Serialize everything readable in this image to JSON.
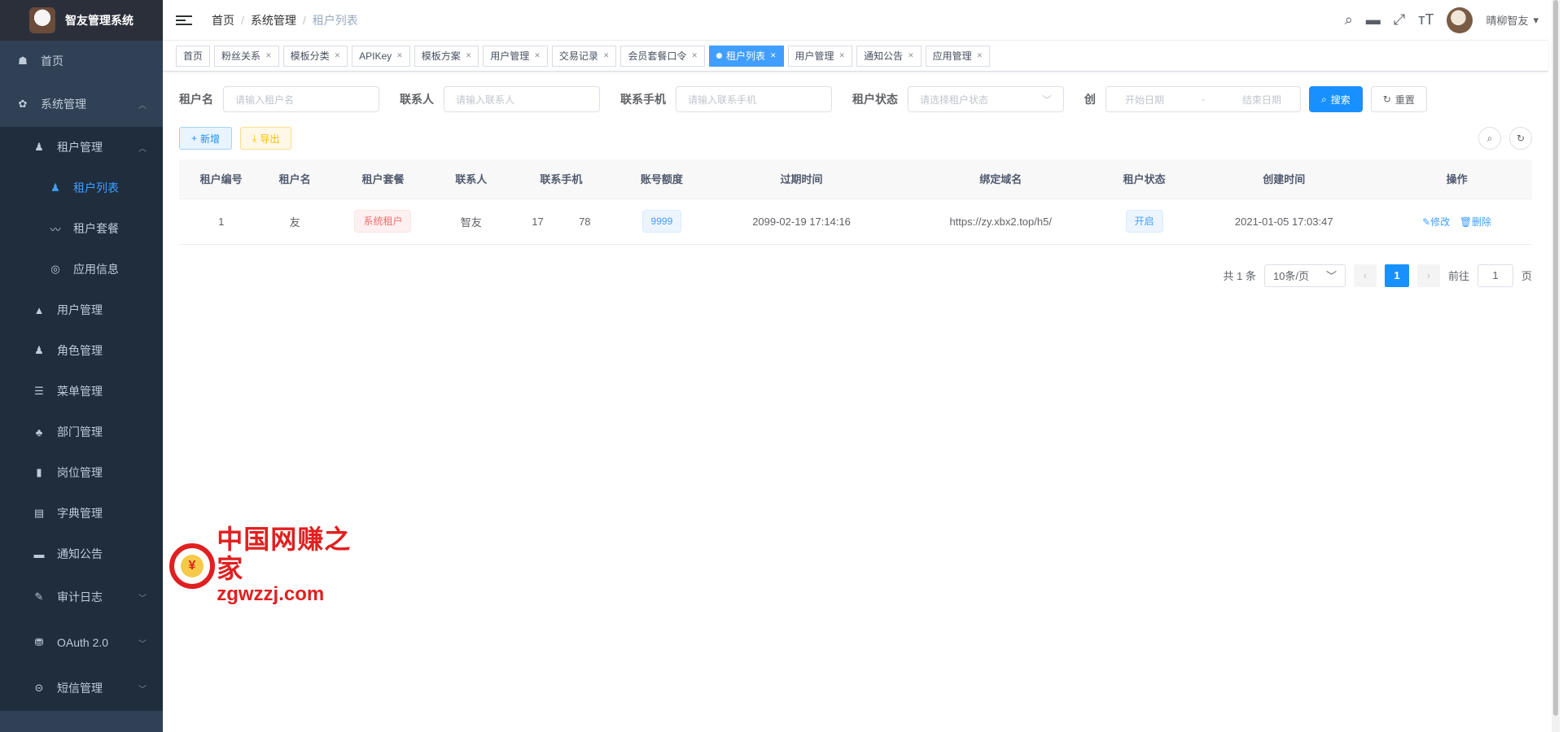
{
  "sidebar": {
    "title": "智友管理系统",
    "home": "首页",
    "system": "系统管理",
    "tenant_mgmt": "租户管理",
    "tenant_list": "租户列表",
    "tenant_package": "租户套餐",
    "app_info": "应用信息",
    "user_mgmt": "用户管理",
    "role_mgmt": "角色管理",
    "menu_mgmt": "菜单管理",
    "dept_mgmt": "部门管理",
    "post_mgmt": "岗位管理",
    "dict_mgmt": "字典管理",
    "notice": "通知公告",
    "audit_log": "审计日志",
    "oauth": "OAuth 2.0",
    "sms": "短信管理"
  },
  "header": {
    "breadcrumb": [
      "首页",
      "系统管理",
      "租户列表"
    ],
    "user_name": "晴柳智友"
  },
  "tags": [
    {
      "label": "首页",
      "closable": false
    },
    {
      "label": "粉丝关系",
      "closable": true
    },
    {
      "label": "模板分类",
      "closable": true
    },
    {
      "label": "APIKey",
      "closable": true
    },
    {
      "label": "模板方案",
      "closable": true
    },
    {
      "label": "用户管理",
      "closable": true
    },
    {
      "label": "交易记录",
      "closable": true
    },
    {
      "label": "会员套餐口令",
      "closable": true
    },
    {
      "label": "租户列表",
      "closable": true,
      "active": true
    },
    {
      "label": "用户管理",
      "closable": true
    },
    {
      "label": "通知公告",
      "closable": true
    },
    {
      "label": "应用管理",
      "closable": true
    }
  ],
  "search": {
    "tenant_name_label": "租户名",
    "tenant_name_ph": "请输入租户名",
    "contact_label": "联系人",
    "contact_ph": "请输入联系人",
    "phone_label": "联系手机",
    "phone_ph": "请输入联系手机",
    "status_label": "租户状态",
    "status_ph": "请选择租户状态",
    "created_label": "创",
    "start_ph": "开始日期",
    "range_sep": "-",
    "end_ph": "结束日期",
    "search_btn": "搜索",
    "reset_btn": "重置"
  },
  "toolbar": {
    "add": "新增",
    "export": "导出"
  },
  "table": {
    "headers": [
      "租户编号",
      "租户名",
      "租户套餐",
      "联系人",
      "联系手机",
      "账号额度",
      "过期时间",
      "绑定域名",
      "租户状态",
      "创建时间",
      "操作"
    ],
    "rows": [
      {
        "id": "1",
        "name": "友",
        "package": "系统租户",
        "contact": "智友",
        "phone_a": "17",
        "phone_b": "78",
        "quota": "9999",
        "expire": "2099-02-19 17:14:16",
        "domain": "https://zy.xbx2.top/h5/",
        "status": "开启",
        "created": "2021-01-05 17:03:47",
        "edit": "修改",
        "delete": "删除"
      }
    ]
  },
  "pagination": {
    "total": "共 1 条",
    "page_size": "10条/页",
    "current": "1",
    "goto_prefix": "前往",
    "goto_value": "1",
    "goto_suffix": "页"
  },
  "watermark": {
    "cn": "中国网赚之家",
    "en": "zgwzzj.com",
    "coin": "¥"
  },
  "colors": {
    "primary": "#1890ff",
    "sidebar_bg": "#304156",
    "danger": "#f56c6c",
    "warning": "#ffba00"
  }
}
